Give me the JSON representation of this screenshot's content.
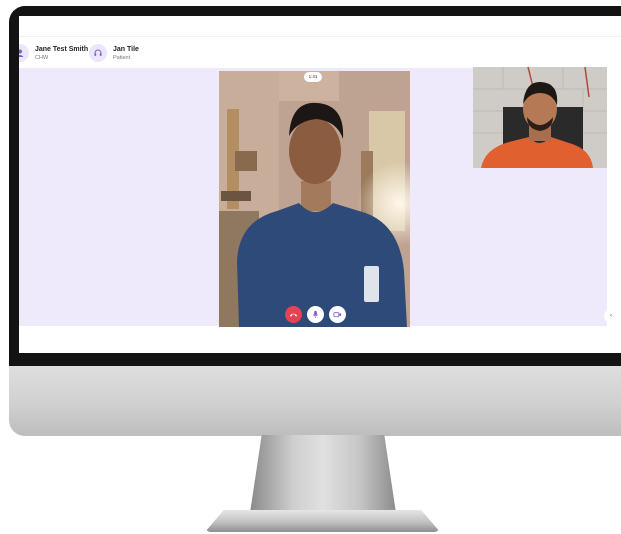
{
  "participants": [
    {
      "name": "Jane Test Smith",
      "role": "CHW",
      "avatar_icon": "user-icon"
    },
    {
      "name": "Jan Tile",
      "role": "Patient",
      "avatar_icon": "headset-icon"
    }
  ],
  "call": {
    "timer": "1:41",
    "controls": [
      {
        "icon": "phone-hangup-icon",
        "color": "#e64253"
      },
      {
        "icon": "microphone-icon",
        "color": "#ffffff"
      },
      {
        "icon": "video-camera-icon",
        "color": "#ffffff"
      }
    ]
  },
  "colors": {
    "call_background": "#efe9fc",
    "accent": "#7b5cd6",
    "end_call": "#e64253",
    "bezel": "#131313"
  }
}
